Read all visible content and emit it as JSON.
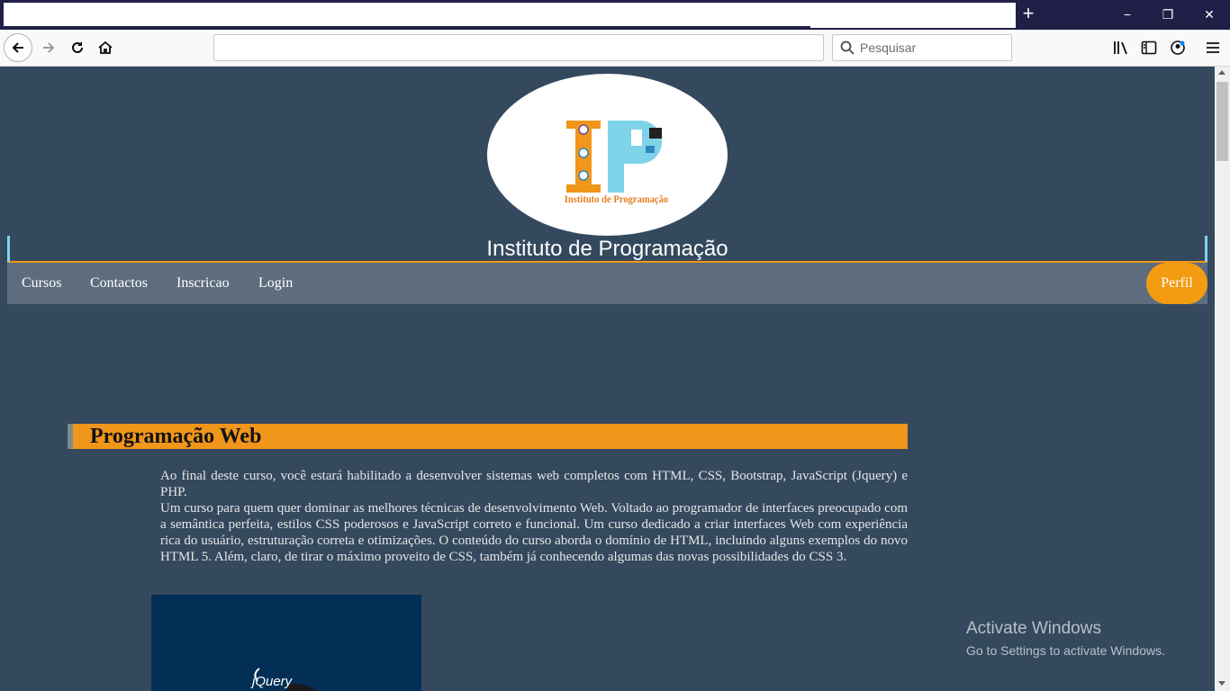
{
  "browser": {
    "new_tab_symbol": "+",
    "window_controls": {
      "minimize": "−",
      "restore": "❐",
      "close": "✕"
    },
    "search": {
      "placeholder": "Pesquisar",
      "value": ""
    },
    "url": {
      "value": ""
    },
    "icons": [
      "back-arrow-icon",
      "forward-arrow-icon",
      "reload-icon",
      "home-icon",
      "search-icon",
      "library-icon",
      "sidebar-icon",
      "account-icon",
      "hamburger-menu-icon"
    ]
  },
  "site": {
    "logo_text": "Instituto de Programação",
    "logo_letters": "IP",
    "title": "Instituto de Programação",
    "menu": [
      "Cursos",
      "Contactos",
      "Inscricao",
      "Login"
    ],
    "profile_button": "Perfil",
    "colors": {
      "background": "#34495e",
      "menu": "#5d6d7e",
      "accent": "#f0961a",
      "border": "#7fd3e8"
    }
  },
  "course": {
    "heading": "Programação Web",
    "paragraph1": "Ao final deste curso, você estará habilitado a desenvolver sistemas web completos com HTML, CSS, Bootstrap, JavaScript (Jquery) e PHP.",
    "paragraph2": "Um curso para quem quer dominar as melhores técnicas de desenvolvimento Web. Voltado ao programador de interfaces preocupado com a semântica perfeita, estilos CSS poderosos e JavaScript correto e funcional. Um curso dedicado a criar interfaces Web com experiência rica do usuário, estruturação correta e otimizações. O conteúdo do curso aborda o domínio de HTML, incluindo alguns exemplos do novo HTML 5. Além, claro, de tirar o máximo proveito de CSS, também já conhecendo algumas das novas possibilidades do CSS 3.",
    "image_label": "jQuery"
  },
  "watermark": {
    "title": "Activate Windows",
    "subtitle": "Go to Settings to activate Windows."
  }
}
